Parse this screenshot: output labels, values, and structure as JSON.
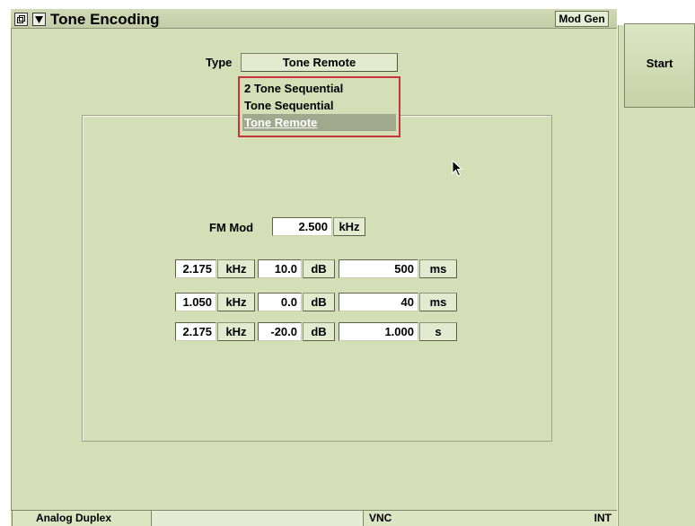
{
  "title_bar": {
    "title": "Tone Encoding",
    "mod_gen_label": "Mod Gen",
    "window_icon": "window-restore-icon",
    "menu_icon": "triangle-down-icon"
  },
  "side_panel": {
    "start_label": "Start"
  },
  "type_selector": {
    "label": "Type",
    "value": "Tone Remote",
    "options": [
      "2 Tone Sequential",
      "Tone Sequential",
      "Tone Remote"
    ]
  },
  "fm_mod": {
    "label": "FM Mod",
    "value": "2.500",
    "unit": "kHz"
  },
  "tones": [
    {
      "freq": "2.175",
      "freq_unit": "kHz",
      "level": "10.0",
      "level_unit": "dB",
      "duration": "500",
      "duration_unit": "ms"
    },
    {
      "freq": "1.050",
      "freq_unit": "kHz",
      "level": "0.0",
      "level_unit": "dB",
      "duration": "40",
      "duration_unit": "ms"
    },
    {
      "freq": "2.175",
      "freq_unit": "kHz",
      "level": "-20.0",
      "level_unit": "dB",
      "duration": "1.000",
      "duration_unit": "s"
    }
  ],
  "status_bar": {
    "mode": "Analog Duplex",
    "middle": "",
    "vnc": "VNC",
    "int": "INT"
  },
  "colors": {
    "panel_bg": "#d4dfb7",
    "dropdown_border": "#c8343a",
    "selected_item": "#a0a98e"
  }
}
